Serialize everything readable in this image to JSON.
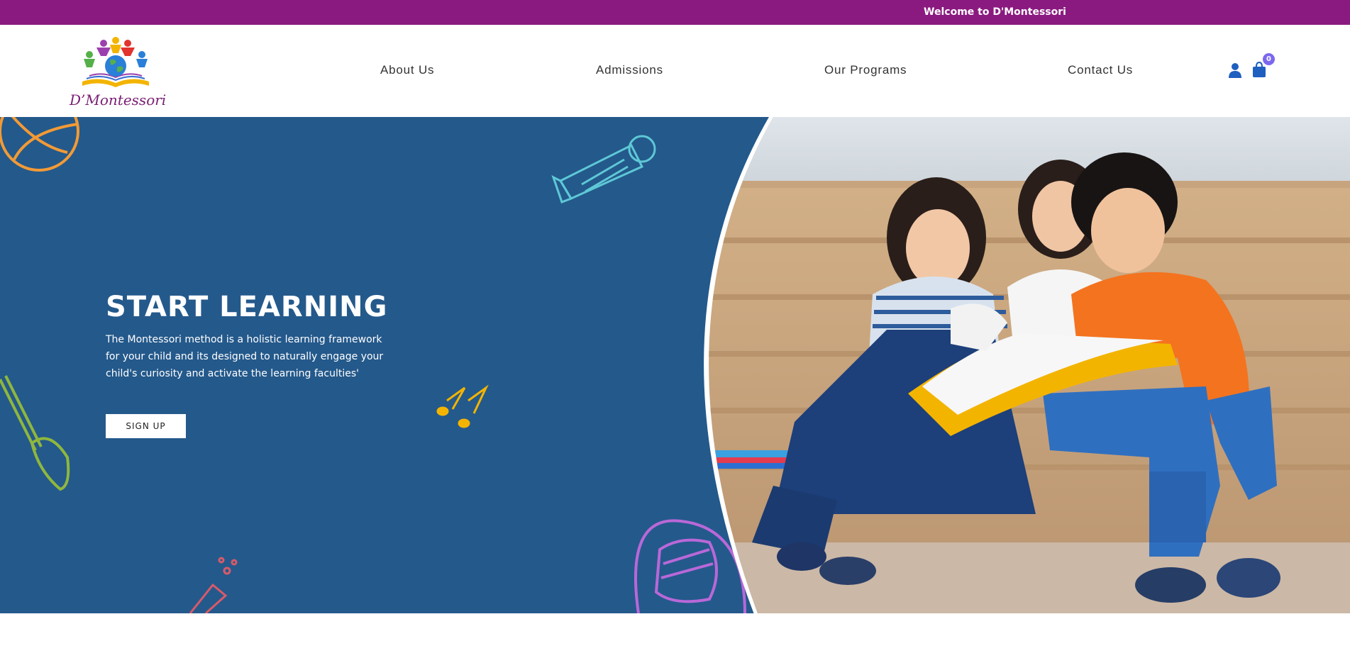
{
  "topbar": {
    "welcome_text": "Welcome to D'Montessori",
    "color": "#8b1a80"
  },
  "logo": {
    "text": "D’Montessori",
    "icon": "globe-with-children-logo"
  },
  "nav": {
    "about": "About Us",
    "admissions": "Admissions",
    "programs": "Our Programs",
    "contact": "Contact Us"
  },
  "header_icons": {
    "user": "user-icon",
    "cart": "shopping-bag-icon",
    "cart_count": "0"
  },
  "hero": {
    "title": "START LEARNING",
    "description": "The Montessori method is a holistic learning framework for your child and its designed to naturally engage your child's curiosity and activate the learning faculties'",
    "button_label": "SIGN UP",
    "background_color": "#24598b",
    "doodles": [
      "ball-doodle-icon",
      "paint-tube-doodle-icon",
      "paintbrush-doodle-icon",
      "music-note-doodle-icon",
      "test-tube-doodle-icon",
      "backpack-doodle-icon"
    ],
    "photo": "children-reading-book-photo"
  }
}
